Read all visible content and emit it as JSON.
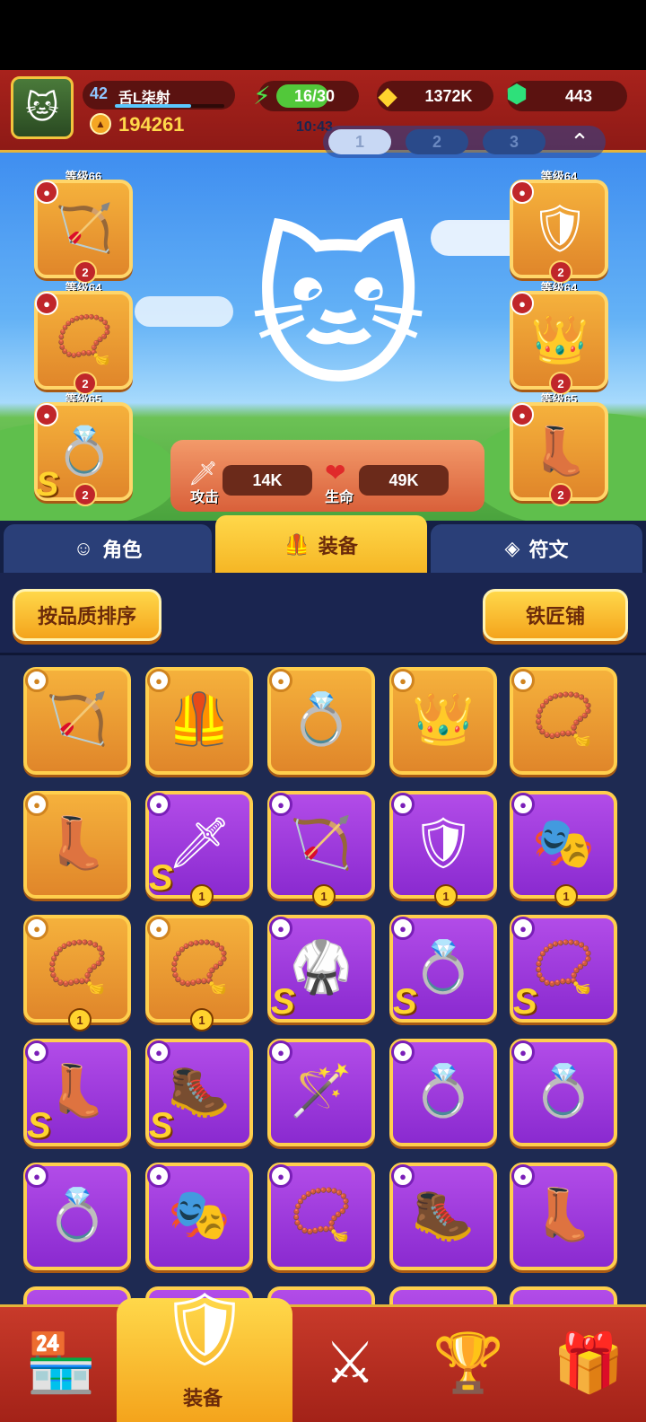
{
  "header": {
    "player_level": "42",
    "player_name": "舌L柒射",
    "power": "194261",
    "energy": "16/30",
    "gold": "1372K",
    "gems": "443",
    "timer": "10:43",
    "loadout_tabs": [
      "1",
      "2",
      "3"
    ]
  },
  "character": {
    "attack_label": "攻击",
    "attack_value": "14K",
    "hp_label": "生命",
    "hp_value": "49K"
  },
  "equipped_left": [
    {
      "level": "等级66",
      "icon": "bow-icon",
      "glyph": "🏹",
      "count": "2",
      "s": false
    },
    {
      "level": "等级64",
      "icon": "necklace-icon",
      "glyph": "📿",
      "count": "2",
      "s": false
    },
    {
      "level": "等级65",
      "icon": "ring-icon",
      "glyph": "💍",
      "count": "2",
      "s": true
    }
  ],
  "equipped_right": [
    {
      "level": "等级64",
      "icon": "armor-icon",
      "glyph": "🛡",
      "count": "2"
    },
    {
      "level": "等级64",
      "icon": "crown-icon",
      "glyph": "👑",
      "count": "2"
    },
    {
      "level": "等级65",
      "icon": "boots-icon",
      "glyph": "👢",
      "count": "2"
    }
  ],
  "tabs": {
    "role": "角色",
    "equipment": "装备",
    "rune": "符文"
  },
  "toolbar": {
    "sort_label": "按品质排序",
    "smith_label": "铁匠铺"
  },
  "inventory": [
    {
      "rarity": "gold",
      "icon": "bow-icon",
      "glyph": "🏹",
      "s": false,
      "count": ""
    },
    {
      "rarity": "gold",
      "icon": "cape-armor-icon",
      "glyph": "🦺",
      "s": false,
      "count": ""
    },
    {
      "rarity": "gold",
      "icon": "ring-icon",
      "glyph": "💍",
      "s": false,
      "count": ""
    },
    {
      "rarity": "gold",
      "icon": "crown-icon",
      "glyph": "👑",
      "s": false,
      "count": ""
    },
    {
      "rarity": "gold",
      "icon": "necklace-icon",
      "glyph": "📿",
      "s": false,
      "count": ""
    },
    {
      "rarity": "gold",
      "icon": "boots-icon",
      "glyph": "👢",
      "s": false,
      "count": ""
    },
    {
      "rarity": "purple",
      "icon": "crossbow-icon",
      "glyph": "🗡",
      "s": true,
      "count": "1"
    },
    {
      "rarity": "purple",
      "icon": "bow-icon",
      "glyph": "🏹",
      "s": false,
      "count": "1"
    },
    {
      "rarity": "purple",
      "icon": "armor-icon",
      "glyph": "🛡",
      "s": false,
      "count": "1"
    },
    {
      "rarity": "purple",
      "icon": "mask-icon",
      "glyph": "🎭",
      "s": false,
      "count": "1"
    },
    {
      "rarity": "gold",
      "icon": "necklace-icon",
      "glyph": "📿",
      "s": false,
      "count": "1"
    },
    {
      "rarity": "gold",
      "icon": "necklace-icon",
      "glyph": "📿",
      "s": false,
      "count": "1"
    },
    {
      "rarity": "purple",
      "icon": "armor-icon",
      "glyph": "🥋",
      "s": true,
      "count": ""
    },
    {
      "rarity": "purple",
      "icon": "ring-icon",
      "glyph": "💍",
      "s": true,
      "count": ""
    },
    {
      "rarity": "purple",
      "icon": "necklace-icon",
      "glyph": "📿",
      "s": true,
      "count": ""
    },
    {
      "rarity": "purple",
      "icon": "boots-icon",
      "glyph": "👢",
      "s": true,
      "count": ""
    },
    {
      "rarity": "purple",
      "icon": "boots-icon",
      "glyph": "🥾",
      "s": true,
      "count": ""
    },
    {
      "rarity": "purple",
      "icon": "wand-icon",
      "glyph": "🪄",
      "s": false,
      "count": ""
    },
    {
      "rarity": "purple",
      "icon": "ring-icon",
      "glyph": "💍",
      "s": false,
      "count": ""
    },
    {
      "rarity": "purple",
      "icon": "ring-icon",
      "glyph": "💍",
      "s": false,
      "count": ""
    },
    {
      "rarity": "purple",
      "icon": "ring-icon",
      "glyph": "💍",
      "s": false,
      "count": ""
    },
    {
      "rarity": "purple",
      "icon": "mask-icon",
      "glyph": "🎭",
      "s": false,
      "count": ""
    },
    {
      "rarity": "purple",
      "icon": "necklace-icon",
      "glyph": "📿",
      "s": false,
      "count": ""
    },
    {
      "rarity": "purple",
      "icon": "boots-icon",
      "glyph": "🥾",
      "s": false,
      "count": ""
    },
    {
      "rarity": "purple",
      "icon": "boots-icon",
      "glyph": "👢",
      "s": false,
      "count": ""
    }
  ],
  "nav": {
    "shop_icon": "🏪",
    "equipment_label": "装备",
    "equipment_icon": "🛡",
    "battle_icon": "⚔",
    "trophy_icon": "🏆",
    "events_icon": "🎁"
  },
  "s_mark": "S"
}
